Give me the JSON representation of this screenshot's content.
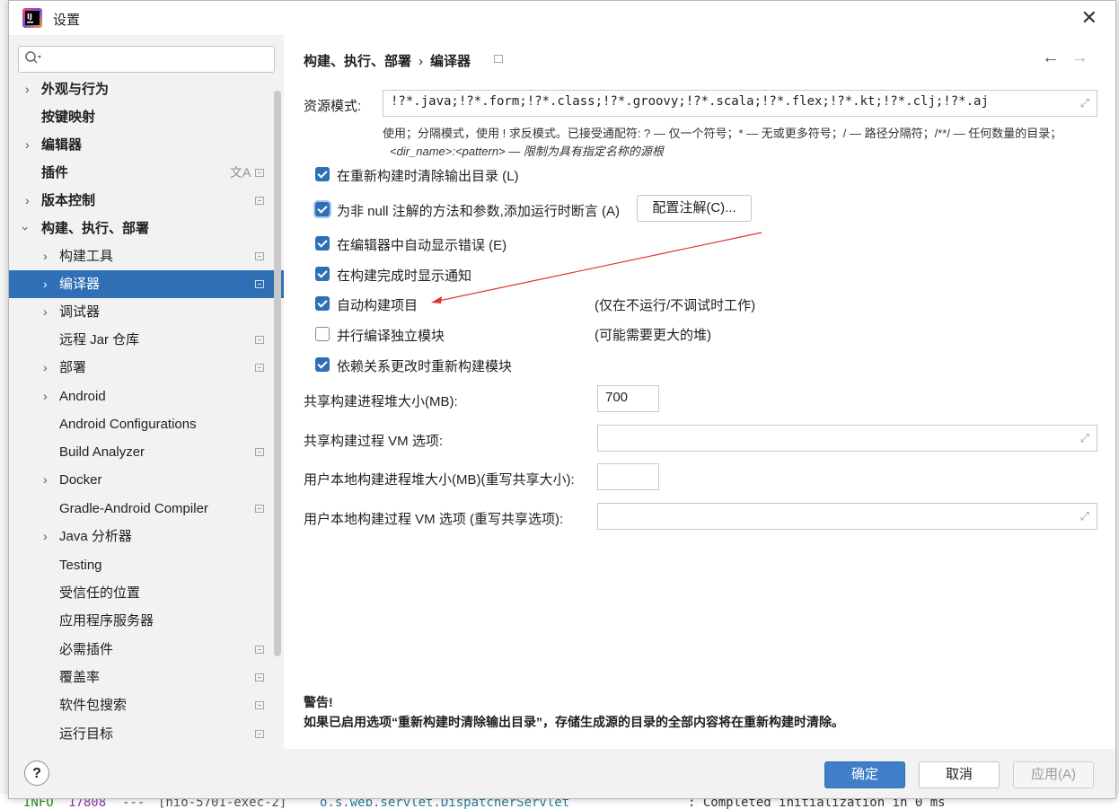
{
  "dialog": {
    "title": "设置"
  },
  "search": {
    "placeholder": ""
  },
  "sidebar": {
    "items": [
      {
        "label": "外观与行为"
      },
      {
        "label": "按键映射"
      },
      {
        "label": "编辑器"
      },
      {
        "label": "插件"
      },
      {
        "label": "版本控制"
      },
      {
        "label": "构建、执行、部署"
      },
      {
        "label": "构建工具"
      },
      {
        "label": "编译器"
      },
      {
        "label": "调试器"
      },
      {
        "label": "远程 Jar 仓库"
      },
      {
        "label": "部署"
      },
      {
        "label": "Android"
      },
      {
        "label": "Android Configurations"
      },
      {
        "label": "Build Analyzer"
      },
      {
        "label": "Docker"
      },
      {
        "label": "Gradle-Android Compiler"
      },
      {
        "label": "Java 分析器"
      },
      {
        "label": "Testing"
      },
      {
        "label": "受信任的位置"
      },
      {
        "label": "应用程序服务器"
      },
      {
        "label": "必需插件"
      },
      {
        "label": "覆盖率"
      },
      {
        "label": "软件包搜索"
      },
      {
        "label": "运行目标"
      }
    ]
  },
  "breadcrumb": {
    "parent": "构建、执行、部署",
    "separator": "›",
    "current": "编译器"
  },
  "resource": {
    "label": "资源模式:",
    "value": "!?*.java;!?*.form;!?*.class;!?*.groovy;!?*.scala;!?*.flex;!?*.kt;!?*.clj;!?*.aj",
    "hint_line1": "使用；分隔模式，使用 ! 求反模式。已接受通配符: ? — 仅一个符号；* — 无或更多符号；/ — 路径分隔符；/**/ — 任何数量的目录；",
    "hint_line2": "<dir_name>:<pattern> — 限制为具有指定名称的源根"
  },
  "options": {
    "clear_output": "在重新构建时清除输出目录 (L)",
    "not_null": "为非 null 注解的方法和参数,添加运行时断言 (A)",
    "configure_annotations": "配置注解(C)...",
    "show_errors": "在编辑器中自动显示错误 (E)",
    "notify": "在构建完成时显示通知",
    "auto_build": "自动构建项目",
    "auto_build_note": "(仅在不运行/不调试时工作)",
    "parallel": "并行编译独立模块",
    "parallel_note": "(可能需要更大的堆)",
    "rebuild_deps": "依赖关系更改时重新构建模块"
  },
  "fields": {
    "shared_heap_label": "共享构建进程堆大小(MB):",
    "shared_heap_value": "700",
    "shared_vm_label": "共享构建过程 VM 选项:",
    "local_heap_label": "用户本地构建进程堆大小(MB)(重写共享大小):",
    "local_vm_label": "用户本地构建过程 VM 选项 (重写共享选项):"
  },
  "warning": {
    "title": "警告!",
    "body": "如果已启用选项“重新构建时清除输出目录”，存储生成源的目录的全部内容将在重新构建时清除。"
  },
  "footer": {
    "help": "?",
    "ok": "确定",
    "cancel": "取消",
    "apply": "应用(A)"
  },
  "background": {
    "log_level": "INFO",
    "log_pid": "17808",
    "log_sep": "---",
    "log_thread": "[nio-5701-exec-2]",
    "log_logger": "o.s.web.servlet.DispatcherServlet",
    "log_message": ": Completed initialization in 0 ms"
  },
  "colors": {
    "accent": "#2f6fb5",
    "primary_button": "#3f7fc8",
    "annotation_arrow": "#e03030"
  }
}
